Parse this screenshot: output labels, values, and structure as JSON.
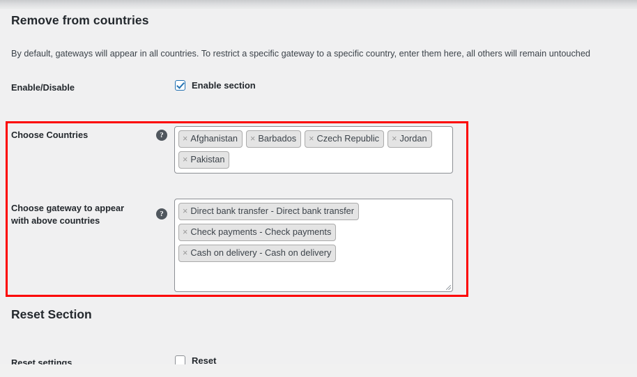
{
  "page": {
    "section_title": "Remove from countries",
    "section_description": "By default, gateways will appear in all countries. To restrict a specific gateway to a specific country, enter them here, all others will remain untouched"
  },
  "enable_row": {
    "label": "Enable/Disable",
    "checkbox_label": "Enable section",
    "checked": true
  },
  "countries_row": {
    "label": "Choose Countries",
    "help_icon": "help-question-icon",
    "help_glyph": "?",
    "tags": [
      {
        "remove_glyph": "×",
        "text": "Afghanistan"
      },
      {
        "remove_glyph": "×",
        "text": "Barbados"
      },
      {
        "remove_glyph": "×",
        "text": "Czech Republic"
      },
      {
        "remove_glyph": "×",
        "text": "Jordan"
      },
      {
        "remove_glyph": "×",
        "text": "Pakistan"
      }
    ]
  },
  "gateways_row": {
    "label_line1": "Choose gateway to appear",
    "label_line2": "with above countries",
    "help_icon": "help-question-icon",
    "help_glyph": "?",
    "tags": [
      {
        "remove_glyph": "×",
        "text": "Direct bank transfer - Direct bank transfer"
      },
      {
        "remove_glyph": "×",
        "text": "Check payments - Check payments"
      },
      {
        "remove_glyph": "×",
        "text": "Cash on delivery - Cash on delivery"
      }
    ]
  },
  "reset_section": {
    "title": "Reset Section",
    "label": "Reset settings",
    "checkbox_label": "Reset",
    "checked": false
  },
  "colors": {
    "highlight_border": "#fc0000",
    "checkbox_checked": "#2271b1",
    "page_background": "#f0f0f1",
    "tag_background": "#e4e4e4"
  }
}
